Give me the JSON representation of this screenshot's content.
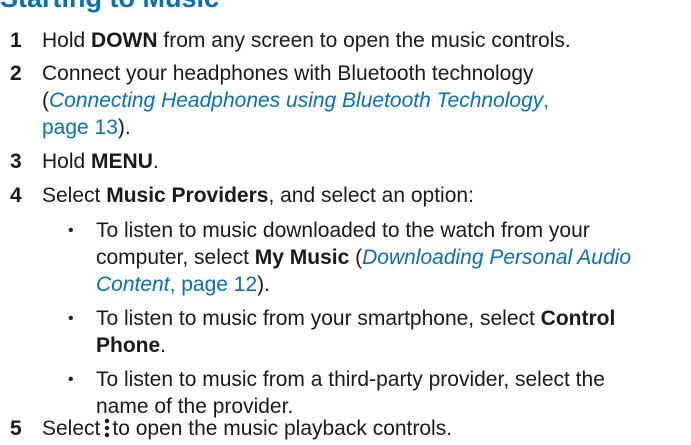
{
  "heading": "Starting to Music",
  "steps": [
    {
      "num": "1",
      "pre": "Hold ",
      "bold": "DOWN",
      "post": " from any screen to open the music controls."
    },
    {
      "num": "2",
      "line1": "Connect your headphones with Bluetooth technology",
      "paren_open": "(",
      "link_italic": "Connecting Headphones using Bluetooth Technology",
      "link_comma": ",",
      "link_page": "page 13",
      "paren_close": ")."
    },
    {
      "num": "3",
      "pre": "Hold ",
      "bold": "MENU",
      "post": "."
    },
    {
      "num": "4",
      "pre": "Select ",
      "bold": "Music Providers",
      "post": ", and select an option:"
    },
    {
      "num": "5",
      "pre": "Select",
      "icon": "vertical-ellipsis-icon",
      "post": "to open the music playback controls."
    }
  ],
  "options": [
    {
      "bullet": "•",
      "line1": "To listen to music downloaded to the watch from your",
      "pre2": "computer, select ",
      "bold": "My Music",
      "paren": " (",
      "link_italic": "Downloading Personal Audio",
      "link_italic2": "Content",
      "link_page": ", page 12",
      "end": ")."
    },
    {
      "bullet": "•",
      "pre": "To listen to music from your smartphone, select ",
      "bold1": "Control",
      "bold2": "Phone",
      "end": "."
    },
    {
      "bullet": "•",
      "line1": "To listen to music from a third-party provider, select the",
      "line2": "name of the provider."
    }
  ]
}
